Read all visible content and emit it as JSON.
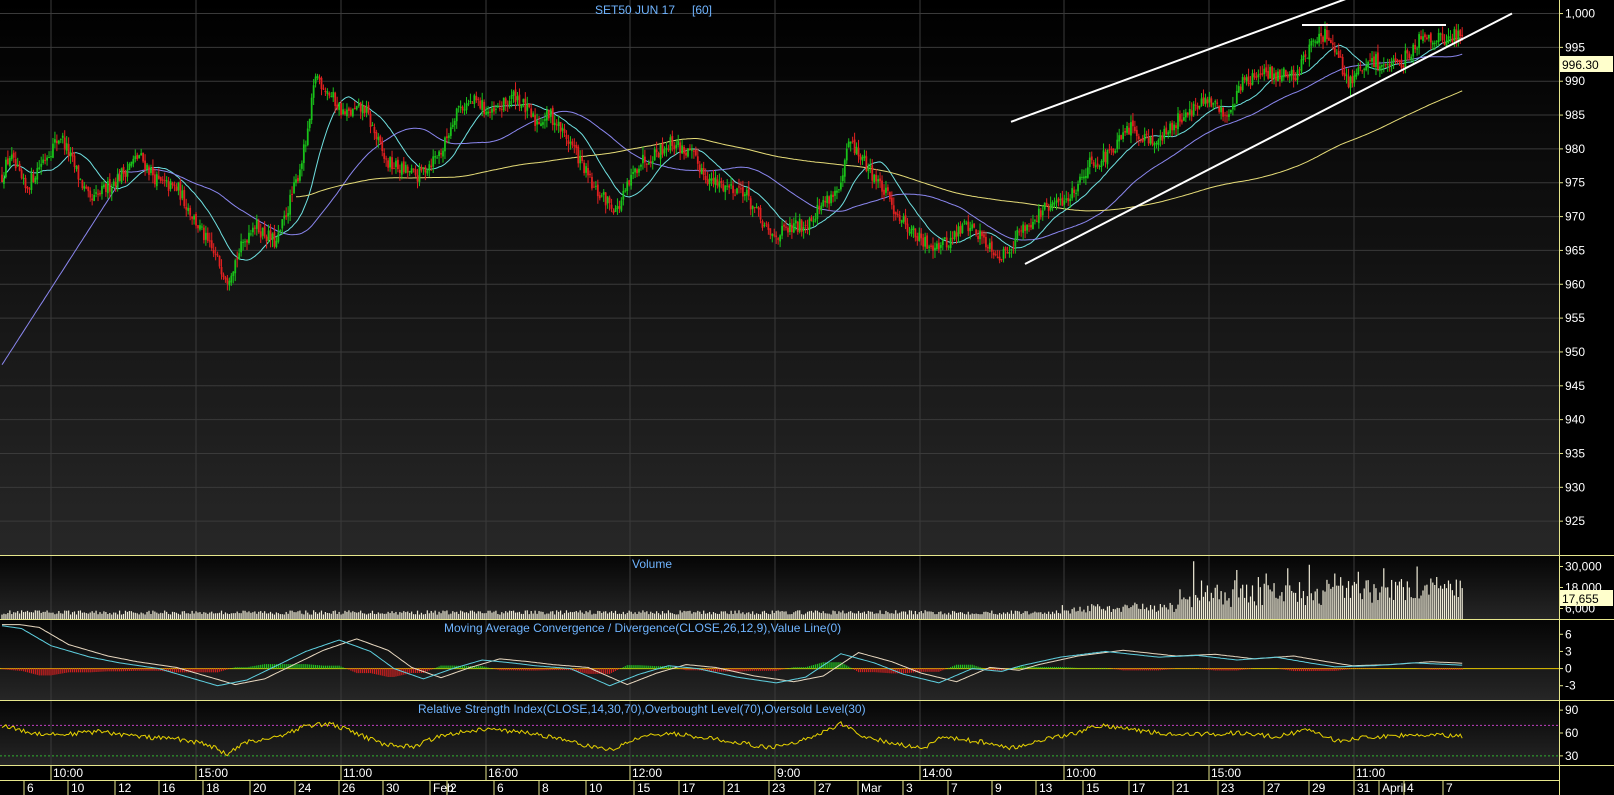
{
  "chart_data": [
    {
      "type": "candlestick",
      "title": "SET50 JUN 17",
      "interval": "[60]",
      "ylim": [
        920,
        1002
      ],
      "yticks": [
        "925",
        "930",
        "935",
        "940",
        "945",
        "950",
        "955",
        "960",
        "965",
        "970",
        "975",
        "980",
        "985",
        "990",
        "995",
        "1,000"
      ],
      "last_price": "996.30",
      "anchors": [
        [
          0,
          976
        ],
        [
          4,
          979
        ],
        [
          12,
          974
        ],
        [
          20,
          978
        ],
        [
          30,
          982
        ],
        [
          45,
          972
        ],
        [
          60,
          976
        ],
        [
          70,
          979
        ],
        [
          80,
          975
        ],
        [
          90,
          974
        ],
        [
          105,
          966
        ],
        [
          115,
          961
        ],
        [
          128,
          969
        ],
        [
          140,
          966
        ],
        [
          150,
          975
        ],
        [
          156,
          982
        ],
        [
          160,
          991
        ],
        [
          165,
          989
        ],
        [
          175,
          985
        ],
        [
          185,
          986
        ],
        [
          196,
          978
        ],
        [
          212,
          976
        ],
        [
          225,
          980
        ],
        [
          232,
          986
        ],
        [
          242,
          987
        ],
        [
          250,
          985
        ],
        [
          262,
          988
        ],
        [
          272,
          984
        ],
        [
          280,
          985
        ],
        [
          292,
          980
        ],
        [
          302,
          974
        ],
        [
          314,
          971
        ],
        [
          325,
          978
        ],
        [
          342,
          981
        ],
        [
          352,
          979
        ],
        [
          362,
          975
        ],
        [
          378,
          974
        ],
        [
          392,
          967
        ],
        [
          410,
          969
        ],
        [
          422,
          973
        ],
        [
          428,
          974
        ],
        [
          432,
          981
        ],
        [
          435,
          980
        ],
        [
          445,
          976
        ],
        [
          458,
          970
        ],
        [
          470,
          966
        ],
        [
          482,
          966
        ],
        [
          492,
          969
        ],
        [
          500,
          967
        ],
        [
          510,
          964
        ],
        [
          520,
          968
        ],
        [
          532,
          971
        ],
        [
          545,
          973
        ],
        [
          555,
          978
        ],
        [
          565,
          979
        ],
        [
          575,
          983
        ],
        [
          590,
          981
        ],
        [
          602,
          985
        ],
        [
          615,
          987
        ],
        [
          625,
          985
        ],
        [
          633,
          990
        ],
        [
          645,
          991
        ],
        [
          660,
          991
        ],
        [
          667,
          995
        ],
        [
          675,
          997
        ],
        [
          682,
          993
        ],
        [
          687,
          990
        ],
        [
          700,
          993
        ],
        [
          712,
          992
        ],
        [
          725,
          997
        ],
        [
          735,
          996
        ],
        [
          745,
          997
        ]
      ],
      "moving_averages": [
        {
          "color": "#6fe0e0",
          "period": 20
        },
        {
          "color": "#8a86ee",
          "period": 60
        },
        {
          "color": "#e6dc78",
          "period": 200
        }
      ],
      "trendlines": [
        {
          "points": [
            [
              1011,
              984
            ],
            [
              1380,
              1004
            ]
          ],
          "color": "#ffffff"
        },
        {
          "points": [
            [
              1025,
              963
            ],
            [
              1512,
              1000
            ]
          ],
          "color": "#ffffff"
        },
        {
          "points": [
            [
              1302,
              998.3
            ],
            [
              1446,
              998.3
            ]
          ],
          "color": "#ffffff"
        }
      ]
    },
    {
      "type": "bar",
      "title": "Volume",
      "yticks": [
        "6,000",
        "18,000",
        "30,000"
      ],
      "ylim": [
        0,
        36000
      ],
      "last_value": "17,655",
      "spikes": [
        [
          608,
          33000
        ],
        [
          612,
          22000
        ],
        [
          630,
          28000
        ],
        [
          645,
          26000
        ],
        [
          656,
          29000
        ],
        [
          667,
          31000
        ],
        [
          680,
          26000
        ],
        [
          692,
          27000
        ],
        [
          705,
          29000
        ],
        [
          722,
          30000
        ],
        [
          732,
          24000
        ],
        [
          738,
          22000
        ]
      ]
    },
    {
      "type": "line",
      "title": "Moving Average Convergence / Divergence(CLOSE,26,12,9),Value Line(0)",
      "yticks": [
        "6",
        "3",
        "0",
        "-3"
      ],
      "ylim": [
        -5.5,
        8.5
      ],
      "series_colors": {
        "macd": "#5fd0e0",
        "signal": "#e8d8c0",
        "hist_pos": "#22c022",
        "hist_neg": "#d02020"
      },
      "anchors": [
        [
          0,
          7.5
        ],
        [
          10,
          7
        ],
        [
          25,
          4
        ],
        [
          45,
          2
        ],
        [
          60,
          1
        ],
        [
          80,
          0
        ],
        [
          95,
          -1.5
        ],
        [
          110,
          -3
        ],
        [
          125,
          -2
        ],
        [
          140,
          0.5
        ],
        [
          155,
          3
        ],
        [
          172,
          5
        ],
        [
          188,
          3
        ],
        [
          200,
          0
        ],
        [
          215,
          -1.8
        ],
        [
          230,
          0
        ],
        [
          245,
          1.5
        ],
        [
          260,
          1
        ],
        [
          272,
          0.5
        ],
        [
          290,
          0
        ],
        [
          310,
          -3
        ],
        [
          325,
          -1
        ],
        [
          340,
          0.5
        ],
        [
          355,
          0
        ],
        [
          375,
          -1.5
        ],
        [
          395,
          -2.5
        ],
        [
          410,
          -1.5
        ],
        [
          428,
          2.6
        ],
        [
          445,
          1
        ],
        [
          460,
          -1
        ],
        [
          478,
          -2.5
        ],
        [
          495,
          0
        ],
        [
          510,
          -0.5
        ],
        [
          520,
          0.5
        ],
        [
          540,
          2
        ],
        [
          563,
          3
        ],
        [
          590,
          2
        ],
        [
          610,
          2.3
        ],
        [
          630,
          1.5
        ],
        [
          650,
          2
        ],
        [
          667,
          1
        ],
        [
          680,
          0.3
        ],
        [
          700,
          0.5
        ],
        [
          720,
          1
        ],
        [
          745,
          0.6
        ]
      ]
    },
    {
      "type": "line",
      "title": "Relative Strength Index(CLOSE,14,30,70),Overbought Level(70),Oversold Level(30)",
      "yticks": [
        "90",
        "60",
        "30"
      ],
      "ylim": [
        18,
        102
      ],
      "levels": [
        70,
        30
      ],
      "series_color": "#e6d200",
      "anchors": [
        [
          0,
          70
        ],
        [
          15,
          60
        ],
        [
          30,
          58
        ],
        [
          50,
          62
        ],
        [
          70,
          55
        ],
        [
          90,
          52
        ],
        [
          105,
          45
        ],
        [
          115,
          32
        ],
        [
          125,
          48
        ],
        [
          140,
          55
        ],
        [
          156,
          70
        ],
        [
          168,
          72
        ],
        [
          180,
          60
        ],
        [
          195,
          45
        ],
        [
          210,
          42
        ],
        [
          225,
          58
        ],
        [
          245,
          65
        ],
        [
          262,
          62
        ],
        [
          280,
          55
        ],
        [
          300,
          42
        ],
        [
          312,
          38
        ],
        [
          325,
          55
        ],
        [
          340,
          60
        ],
        [
          355,
          55
        ],
        [
          375,
          48
        ],
        [
          392,
          40
        ],
        [
          410,
          52
        ],
        [
          428,
          72
        ],
        [
          440,
          55
        ],
        [
          458,
          45
        ],
        [
          470,
          40
        ],
        [
          480,
          55
        ],
        [
          500,
          48
        ],
        [
          515,
          40
        ],
        [
          532,
          52
        ],
        [
          545,
          58
        ],
        [
          560,
          70
        ],
        [
          575,
          65
        ],
        [
          590,
          60
        ],
        [
          610,
          58
        ],
        [
          630,
          60
        ],
        [
          650,
          55
        ],
        [
          667,
          65
        ],
        [
          680,
          50
        ],
        [
          700,
          55
        ],
        [
          720,
          58
        ],
        [
          745,
          56
        ]
      ]
    }
  ],
  "x_axis": {
    "time_labels": [
      "10:00",
      "15:00",
      "11:00",
      "16:00",
      "12:00",
      "9:00",
      "14:00",
      "10:00",
      "15:00",
      "11:00"
    ],
    "date_labels": [
      "6",
      "10",
      "12",
      "16",
      "18",
      "20",
      "24",
      "26",
      "30",
      "Feb",
      "2",
      "6",
      "8",
      "10",
      "15",
      "17",
      "21",
      "23",
      "27",
      "Mar",
      "3",
      "7",
      "9",
      "13",
      "15",
      "17",
      "21",
      "23",
      "27",
      "29",
      "31",
      "April",
      "4",
      "7"
    ]
  },
  "colors": {
    "up": "#19c219",
    "down": "#e02020",
    "frame": "#e6e68c",
    "axis_text": "#ffffff",
    "title_text": "#6fb4ff",
    "grid": "#3a3a3a"
  }
}
